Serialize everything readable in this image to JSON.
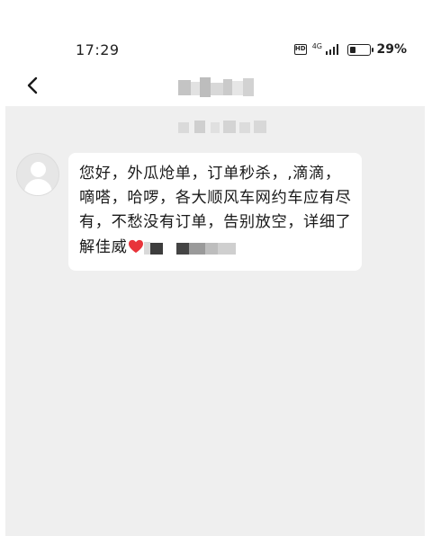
{
  "status_bar": {
    "time": "17:29",
    "hd_label": "HD",
    "network": "4G",
    "battery_level": 0.29,
    "battery_text": "29%"
  },
  "nav": {
    "back_icon": "chevron-left-icon",
    "contact_name": ""
  },
  "chat": {
    "timestamp": "",
    "messages": [
      {
        "sender": "incoming",
        "avatar_icon": "default-avatar-icon",
        "text": "您好，外瓜炝单，订单秒杀，,滴滴，嘀嗒，哈啰，各大顺风车网约车应有尽有，不愁没有订单，告别放空，详细了解佳威",
        "emoji_icon": "red-heart-icon",
        "tail_redacted": ""
      }
    ]
  },
  "colors": {
    "chat_background": "#efefef",
    "bubble": "#ffffff",
    "heart": "#e8333a",
    "text": "#1a1a1a"
  }
}
